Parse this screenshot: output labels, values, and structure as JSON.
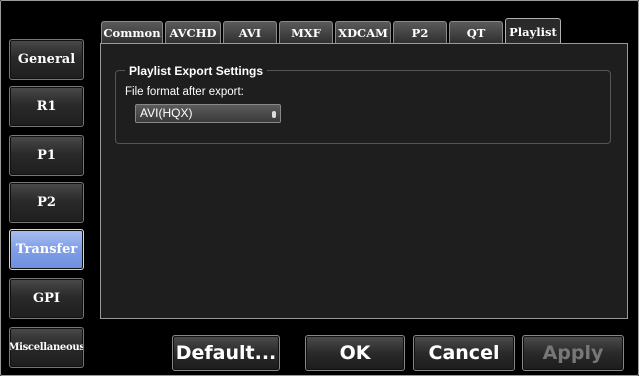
{
  "sidebar": {
    "items": [
      {
        "label": "General"
      },
      {
        "label": "R1"
      },
      {
        "label": "P1"
      },
      {
        "label": "P2"
      },
      {
        "label": "Transfer",
        "active": true
      },
      {
        "label": "GPI"
      },
      {
        "label": "Miscellaneous"
      }
    ]
  },
  "tabs": [
    {
      "label": "Common"
    },
    {
      "label": "AVCHD"
    },
    {
      "label": "AVI"
    },
    {
      "label": "MXF"
    },
    {
      "label": "XDCAM"
    },
    {
      "label": "P2"
    },
    {
      "label": "QT"
    },
    {
      "label": "Playlist",
      "active": true
    }
  ],
  "panel": {
    "group_title": "Playlist Export Settings",
    "file_format_label": "File format after export:",
    "file_format_value": "AVI(HQX)"
  },
  "buttons": {
    "default": "Default...",
    "ok": "OK",
    "cancel": "Cancel",
    "apply": "Apply"
  },
  "colors": {
    "active_side": "#7f9ee6",
    "background": "#000000",
    "panel": "#1e1e1e"
  }
}
